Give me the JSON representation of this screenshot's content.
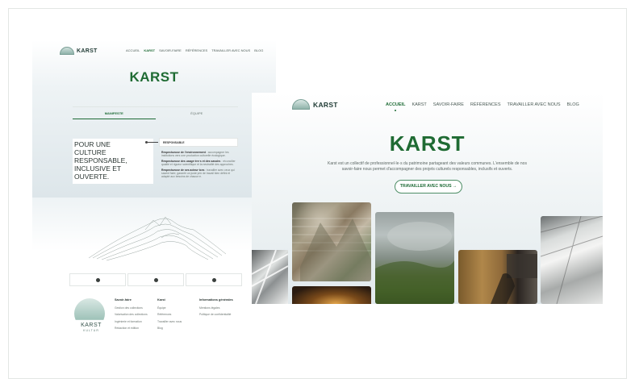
{
  "left_page": {
    "brand": "KARST",
    "menu": [
      "ACCUEIL",
      "KARST",
      "SAVOIR-FAIRE",
      "RÉFÉRENCES",
      "TRAVAILLER AVEC NOUS",
      "BLOG"
    ],
    "active_menu": "KARST",
    "title": "KARST",
    "tabs": [
      "MANIFESTE",
      "ÉQUIPE"
    ],
    "heading": "POUR UNE CULTURE RESPONSABLE, INCLUSIVE ET OUVERTE.",
    "badge": "RESPONSABLE",
    "body": [
      {
        "bold": "Respectueuse de l'environnement",
        "text": " : accompagner les institutions vers une production culturelle écologique."
      },
      {
        "bold": "Respectueuse des usage·ère·s et des savoirs",
        "text": " : réconcilier qualité et rigueur scientifique et la neutralité des approches."
      },
      {
        "bold": "Respectueuse de ses acteur·ices",
        "text": " : travailler avec ceux qui savent faire, garantir un juste prix de travail bien défini et adapté aux besoins de chacun·e."
      }
    ],
    "footer": {
      "logo_text": "KARST",
      "logo_sub": "KULTUR",
      "columns": [
        {
          "title": "Savoir-faire",
          "items": [
            "Gestion des collections",
            "Valorisation des collections",
            "Ingénierie et formation",
            "Rédaction et édition"
          ]
        },
        {
          "title": "Karst",
          "items": [
            "Équipe",
            "Références",
            "Travailler avec nous",
            "Blog"
          ]
        },
        {
          "title": "Informations générales",
          "items": [
            "Mentions légales",
            "Politique de confidentialité"
          ]
        }
      ]
    }
  },
  "right_page": {
    "brand": "KARST",
    "menu": [
      "ACCUEIL",
      "KARST",
      "SAVOIR-FAIRE",
      "RÉFÉRENCES",
      "TRAVAILLER AVEC NOUS",
      "BLOG"
    ],
    "active_menu": "ACCUEIL",
    "title": "KARST",
    "description": "Karst est un collectif de professionnel·le·s du patrimoine partageant des valeurs communes. L'ensemble de nos savoir-faire nous permet d'accompagner des projets culturels responsables, inclusifs et ouverts.",
    "cta": "TRAVAILLER AVEC NOUS →"
  },
  "colors": {
    "brand_green": "#1f6b33",
    "accent_green": "#1e6b36",
    "text_dark": "#2a3532"
  }
}
